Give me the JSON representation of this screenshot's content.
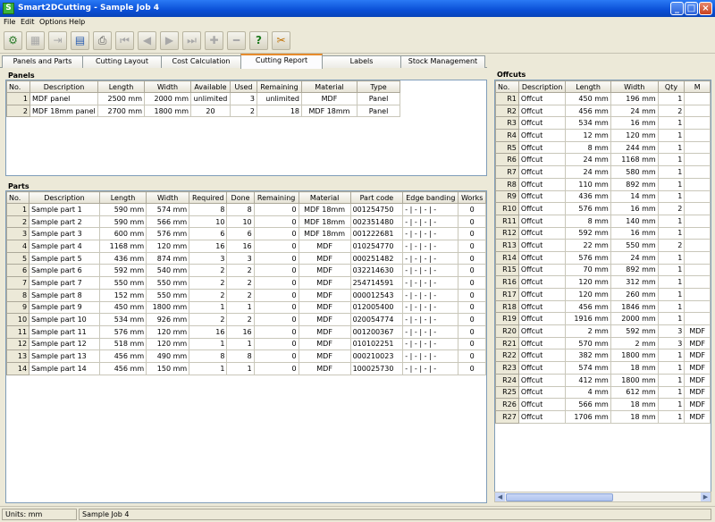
{
  "window": {
    "title": "Smart2DCutting - Sample Job 4",
    "app_icon": "app-icon"
  },
  "menu": [
    "File",
    "Edit",
    "Options",
    "Help"
  ],
  "tabs": [
    "Panels and Parts",
    "Cutting Layout",
    "Cost Calculation",
    "Cutting Report",
    "Labels",
    "Stock Management"
  ],
  "active_tab": "Cutting Report",
  "panels": {
    "title": "Panels",
    "columns": [
      "No.",
      "Description",
      "Length",
      "Width",
      "Available",
      "Used",
      "Remaining",
      "Material",
      "Type"
    ],
    "rows": [
      [
        "1",
        "MDF panel",
        "2500 mm",
        "2000 mm",
        "unlimited",
        "3",
        "unlimited",
        "MDF",
        "Panel"
      ],
      [
        "2",
        "MDF 18mm panel",
        "2700 mm",
        "1800 mm",
        "20",
        "2",
        "18",
        "MDF 18mm",
        "Panel"
      ]
    ]
  },
  "parts": {
    "title": "Parts",
    "columns": [
      "No.",
      "Description",
      "Length",
      "Width",
      "Required",
      "Done",
      "Remaining",
      "Material",
      "Part code",
      "Edge banding",
      "Works"
    ],
    "rows": [
      [
        "1",
        "Sample part 1",
        "590 mm",
        "574 mm",
        "8",
        "8",
        "0",
        "MDF 18mm",
        "001254750",
        "- | - | - | -",
        "0"
      ],
      [
        "2",
        "Sample part 2",
        "590 mm",
        "566 mm",
        "10",
        "10",
        "0",
        "MDF 18mm",
        "002351480",
        "- | - | - | -",
        "0"
      ],
      [
        "3",
        "Sample part 3",
        "600 mm",
        "576 mm",
        "6",
        "6",
        "0",
        "MDF 18mm",
        "001222681",
        "- | - | - | -",
        "0"
      ],
      [
        "4",
        "Sample part 4",
        "1168 mm",
        "120 mm",
        "16",
        "16",
        "0",
        "MDF",
        "010254770",
        "- | - | - | -",
        "0"
      ],
      [
        "5",
        "Sample part 5",
        "436 mm",
        "874 mm",
        "3",
        "3",
        "0",
        "MDF",
        "000251482",
        "- | - | - | -",
        "0"
      ],
      [
        "6",
        "Sample part 6",
        "592 mm",
        "540 mm",
        "2",
        "2",
        "0",
        "MDF",
        "032214630",
        "- | - | - | -",
        "0"
      ],
      [
        "7",
        "Sample part 7",
        "550 mm",
        "550 mm",
        "2",
        "2",
        "0",
        "MDF",
        "254714591",
        "- | - | - | -",
        "0"
      ],
      [
        "8",
        "Sample part 8",
        "152 mm",
        "550 mm",
        "2",
        "2",
        "0",
        "MDF",
        "000012543",
        "- | - | - | -",
        "0"
      ],
      [
        "9",
        "Sample part 9",
        "450 mm",
        "1800 mm",
        "1",
        "1",
        "0",
        "MDF",
        "012005400",
        "- | - | - | -",
        "0"
      ],
      [
        "10",
        "Sample part 10",
        "534 mm",
        "926 mm",
        "2",
        "2",
        "0",
        "MDF",
        "020054774",
        "- | - | - | -",
        "0"
      ],
      [
        "11",
        "Sample part 11",
        "576 mm",
        "120 mm",
        "16",
        "16",
        "0",
        "MDF",
        "001200367",
        "- | - | - | -",
        "0"
      ],
      [
        "12",
        "Sample part 12",
        "518 mm",
        "120 mm",
        "1",
        "1",
        "0",
        "MDF",
        "010102251",
        "- | - | - | -",
        "0"
      ],
      [
        "13",
        "Sample part 13",
        "456 mm",
        "490 mm",
        "8",
        "8",
        "0",
        "MDF",
        "000210023",
        "- | - | - | -",
        "0"
      ],
      [
        "14",
        "Sample part 14",
        "456 mm",
        "150 mm",
        "1",
        "1",
        "0",
        "MDF",
        "100025730",
        "- | - | - | -",
        "0"
      ]
    ]
  },
  "offcuts": {
    "title": "Offcuts",
    "columns": [
      "No.",
      "Description",
      "Length",
      "Width",
      "Qty",
      "M"
    ],
    "rows": [
      [
        "R1",
        "Offcut",
        "450 mm",
        "196 mm",
        "1",
        ""
      ],
      [
        "R2",
        "Offcut",
        "456 mm",
        "24 mm",
        "2",
        ""
      ],
      [
        "R3",
        "Offcut",
        "534 mm",
        "16 mm",
        "1",
        ""
      ],
      [
        "R4",
        "Offcut",
        "12 mm",
        "120 mm",
        "1",
        ""
      ],
      [
        "R5",
        "Offcut",
        "8 mm",
        "244 mm",
        "1",
        ""
      ],
      [
        "R6",
        "Offcut",
        "24 mm",
        "1168 mm",
        "1",
        ""
      ],
      [
        "R7",
        "Offcut",
        "24 mm",
        "580 mm",
        "1",
        ""
      ],
      [
        "R8",
        "Offcut",
        "110 mm",
        "892 mm",
        "1",
        ""
      ],
      [
        "R9",
        "Offcut",
        "436 mm",
        "14 mm",
        "1",
        ""
      ],
      [
        "R10",
        "Offcut",
        "576 mm",
        "16 mm",
        "2",
        ""
      ],
      [
        "R11",
        "Offcut",
        "8 mm",
        "140 mm",
        "1",
        ""
      ],
      [
        "R12",
        "Offcut",
        "592 mm",
        "16 mm",
        "1",
        ""
      ],
      [
        "R13",
        "Offcut",
        "22 mm",
        "550 mm",
        "2",
        ""
      ],
      [
        "R14",
        "Offcut",
        "576 mm",
        "24 mm",
        "1",
        ""
      ],
      [
        "R15",
        "Offcut",
        "70 mm",
        "892 mm",
        "1",
        ""
      ],
      [
        "R16",
        "Offcut",
        "120 mm",
        "312 mm",
        "1",
        ""
      ],
      [
        "R17",
        "Offcut",
        "120 mm",
        "260 mm",
        "1",
        ""
      ],
      [
        "R18",
        "Offcut",
        "456 mm",
        "1846 mm",
        "1",
        ""
      ],
      [
        "R19",
        "Offcut",
        "1916 mm",
        "2000 mm",
        "1",
        ""
      ],
      [
        "R20",
        "Offcut",
        "2 mm",
        "592 mm",
        "3",
        "MDF"
      ],
      [
        "R21",
        "Offcut",
        "570 mm",
        "2 mm",
        "3",
        "MDF"
      ],
      [
        "R22",
        "Offcut",
        "382 mm",
        "1800 mm",
        "1",
        "MDF"
      ],
      [
        "R23",
        "Offcut",
        "574 mm",
        "18 mm",
        "1",
        "MDF"
      ],
      [
        "R24",
        "Offcut",
        "412 mm",
        "1800 mm",
        "1",
        "MDF"
      ],
      [
        "R25",
        "Offcut",
        "4 mm",
        "612 mm",
        "1",
        "MDF"
      ],
      [
        "R26",
        "Offcut",
        "566 mm",
        "18 mm",
        "1",
        "MDF"
      ],
      [
        "R27",
        "Offcut",
        "1706 mm",
        "18 mm",
        "1",
        "MDF"
      ]
    ]
  },
  "status": {
    "units": "Units: mm",
    "job": "Sample Job 4"
  },
  "toolbar_icons": [
    "settings-icon",
    "calculator-icon",
    "export-icon",
    "open-icon",
    "print-icon",
    "first-icon",
    "prev-icon",
    "next-icon",
    "last-icon",
    "add-icon",
    "remove-icon",
    "help-icon",
    "tools-icon"
  ]
}
